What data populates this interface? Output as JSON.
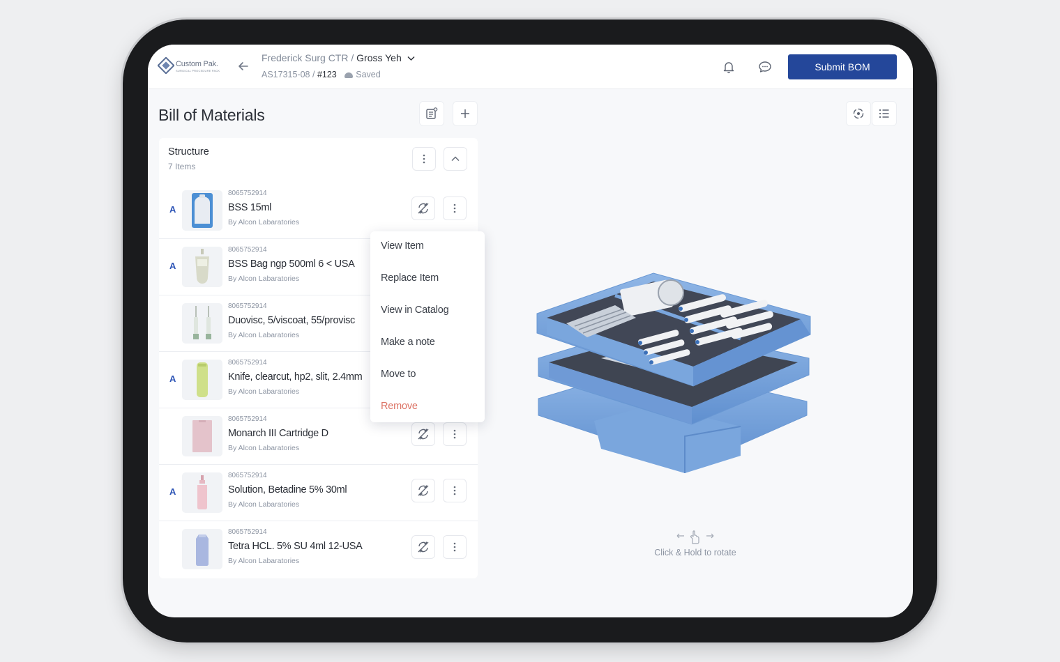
{
  "header": {
    "logo_name": "Custom Pak.",
    "logo_sub": "SURGICAL PROCEDURE PACK",
    "breadcrumb_parent": "Frederick Surg CTR",
    "breadcrumb_separator": " / ",
    "breadcrumb_current": "Gross Yeh",
    "doc_id": "AS17315-08",
    "doc_number": "#123",
    "save_status": "Saved",
    "submit_label": "Submit BOM"
  },
  "bom": {
    "title": "Bill of Materials"
  },
  "structure": {
    "title": "Structure",
    "count_label": "7 Items",
    "items": [
      {
        "badge": "A",
        "sku": "8065752914",
        "name": "BSS 15ml",
        "brand": "By Alcon Labaratories"
      },
      {
        "badge": "A",
        "sku": "8065752914",
        "name": "BSS Bag ngp 500ml 6 < USA",
        "brand": "By Alcon Labaratories"
      },
      {
        "badge": "",
        "sku": "8065752914",
        "name": "Duovisc, 5/viscoat, 55/provisc",
        "brand": "By Alcon Labaratories"
      },
      {
        "badge": "A",
        "sku": "8065752914",
        "name": "Knife, clearcut, hp2, slit, 2.4mm",
        "brand": "By Alcon Labaratories"
      },
      {
        "badge": "",
        "sku": "8065752914",
        "name": "Monarch III Cartridge D",
        "brand": "By Alcon Labaratories"
      },
      {
        "badge": "A",
        "sku": "8065752914",
        "name": "Solution, Betadine 5% 30ml",
        "brand": "By Alcon Labaratories"
      },
      {
        "badge": "",
        "sku": "8065752914",
        "name": "Tetra HCL. 5% SU 4ml 12-USA",
        "brand": "By Alcon Labaratories"
      }
    ]
  },
  "context_menu": {
    "items": [
      "View Item",
      "Replace Item",
      "View in Catalog",
      "Make a note",
      "Move to"
    ],
    "danger_item": "Remove",
    "danger_color": "#dc7466"
  },
  "viewer": {
    "hint": "Click & Hold to rotate"
  },
  "colors": {
    "brand_blue": "#24479a",
    "badge_blue": "#2e55b6",
    "tray_blue": "#7aa6dd"
  },
  "icons": [
    "back-arrow-icon",
    "chevron-down-icon",
    "cloud-icon",
    "bell-icon",
    "chat-icon",
    "notes-icon",
    "plus-icon",
    "rotate-3d-icon",
    "list-icon",
    "more-vertical-icon",
    "chevron-up-icon",
    "replace-icon"
  ]
}
